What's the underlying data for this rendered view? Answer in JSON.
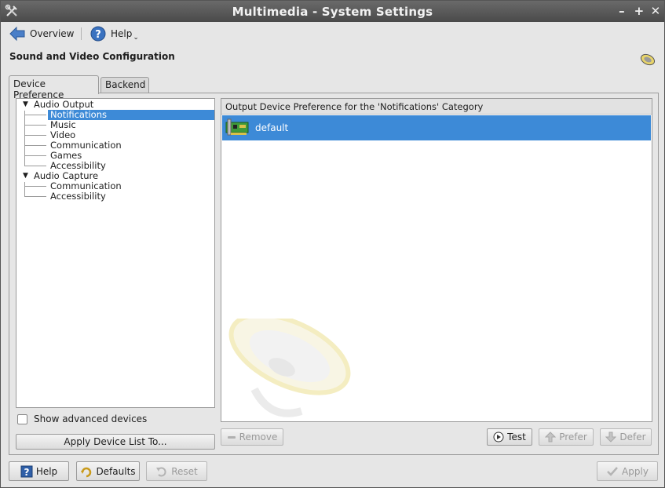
{
  "window": {
    "title": "Multimedia - System Settings"
  },
  "toolbar": {
    "overview_label": "Overview",
    "help_label": "Help"
  },
  "page": {
    "heading": "Sound and Video Configuration"
  },
  "tabs": [
    {
      "label": "Device Preference"
    },
    {
      "label": "Backend"
    }
  ],
  "tree": {
    "groups": [
      {
        "label": "Audio Output",
        "children": [
          "Notifications",
          "Music",
          "Video",
          "Communication",
          "Games",
          "Accessibility"
        ]
      },
      {
        "label": "Audio Capture",
        "children": [
          "Communication",
          "Accessibility"
        ]
      }
    ],
    "selected": "Notifications"
  },
  "options": {
    "show_advanced_label": "Show advanced devices",
    "apply_list_label": "Apply Device List To..."
  },
  "device_list": {
    "header": "Output Device Preference for the 'Notifications' Category",
    "devices": [
      {
        "name": "default"
      }
    ]
  },
  "device_buttons": {
    "remove": "Remove",
    "test": "Test",
    "prefer": "Prefer",
    "defer": "Defer"
  },
  "bottom_buttons": {
    "help": "Help",
    "defaults": "Defaults",
    "reset": "Reset",
    "apply": "Apply"
  },
  "colors": {
    "selection": "#3d8ad7",
    "titlebar": "#555555"
  },
  "icons": [
    "settings-icon",
    "back-arrow-icon",
    "help-icon",
    "speaker-icon",
    "sound-card-icon",
    "play-icon",
    "up-arrow-icon",
    "down-arrow-icon",
    "defaults-icon",
    "reset-icon",
    "apply-check-icon",
    "remove-icon"
  ]
}
